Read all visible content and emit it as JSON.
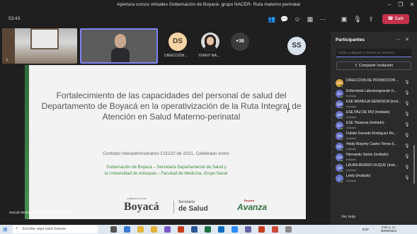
{
  "window": {
    "title": "Apertura cursos virtuales Gobernación de Boyacá- grupo NACER- Ruta materno perinatal"
  },
  "toolbar": {
    "timer": "53:43",
    "leave_label": "Salir",
    "accent_color": "#8b8cf0",
    "leave_color": "#c4314b"
  },
  "videos": [
    {
      "label": "L"
    },
    {
      "label": ""
    }
  ],
  "avatars": [
    {
      "initials": "DS",
      "name": "DIRECCIÓN ..."
    },
    {
      "initials": "",
      "name": "YENNY MA..."
    },
    {
      "initials": "+36",
      "name": ""
    },
    {
      "initials": "SS",
      "name": ""
    }
  ],
  "slide": {
    "title": "Fortalecimiento de las capacidades del personal de salud del Departamento de Boyacá en la operativización de la Ruta Integral de Atención en Salud Materno-perinatal",
    "contract": "Contrato Interadministrativo CI2222 de 2021, Celebrado entre:",
    "parties_line1": "Gobernación de Boyacá – Secretaria Departamental de Salud y",
    "parties_line2": "la Universidad de Antioquia – Facultad de Medicina, Grupo Nacer",
    "logo_gob": "GOBERNACIÓN DE",
    "logo_boyaca": "Boyacá",
    "logo_secretaria": "Secretaría",
    "logo_salud": "de Salud",
    "logo_avanza_top": "Boyacá",
    "logo_avanza": "Avanza",
    "footer": "SALUD SEXUAL Y REPRODUCTIVA SALVE"
  },
  "panel": {
    "title": "Participantes",
    "invite_placeholder": "Invita a alguien o marca un número",
    "share_label": "Compartir invitación",
    "see_more": "Ver más",
    "participants": [
      {
        "initials": "DD",
        "name": "DIRECCIÓN DE PROMOCIÓN ...",
        "role": "",
        "color": "orange"
      },
      {
        "initials": "EL",
        "name": "Enfermeria Labranzagrande (I...",
        "role": "Invitado",
        "color": "blue"
      },
      {
        "initials": "EM",
        "name": "ESE MONGUA GERENCIA (Invit...",
        "role": "Invitado",
        "color": "blue"
      },
      {
        "initials": "EP",
        "name": "ESE PAZ DE RIO (Invitado)",
        "role": "Invitado",
        "color": "blue"
      },
      {
        "initials": "ET",
        "name": "ESE Tibasosa (Invitado)",
        "role": "Invitado",
        "color": "blue"
      },
      {
        "initials": "FR",
        "name": "Fabián Gerardo Rodriguez Re...",
        "role": "Invitado",
        "color": "blue"
      },
      {
        "initials": "HC",
        "name": "Heidy Mayerly Castro Torres (I...",
        "role": "Invitado",
        "color": "blue"
      },
      {
        "initials": "HS",
        "name": "Hernando Santiz (Invitado)",
        "role": "Invitado",
        "color": "blue"
      },
      {
        "initials": "LB",
        "name": "LAURA BERRIO DUQUE (Invit...",
        "role": "Invitado",
        "color": "blue"
      },
      {
        "initials": "L",
        "name": "Leidy (Invitado)",
        "role": "Invitado",
        "color": "blue"
      }
    ]
  },
  "taskbar": {
    "search_placeholder": "Escribe aquí para buscar",
    "lang": "ESP",
    "time": "9:04 a. m.",
    "date": "09/09/2021"
  }
}
